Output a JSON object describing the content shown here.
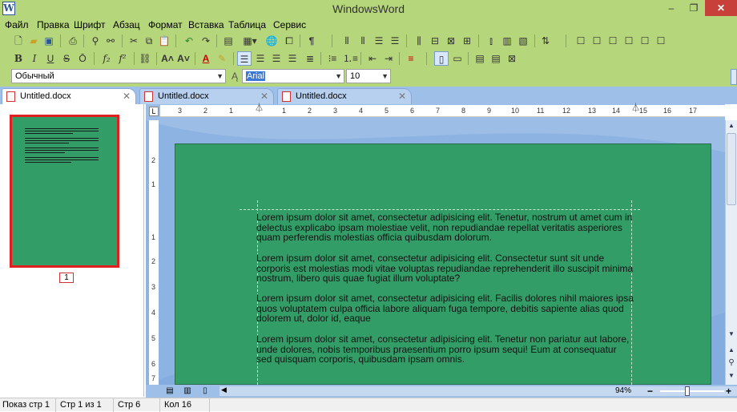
{
  "window": {
    "title": "WindowsWord",
    "app_icon_letter": "W",
    "minimize": "‒",
    "maximize": "❐",
    "close": "✕"
  },
  "menu": [
    "Файл",
    "Правка",
    "Шрифт",
    "Абзац",
    "Формат",
    "Вставка",
    "Таблица",
    "Сервис"
  ],
  "format_bar": {
    "style": "Обычный",
    "font": "Arial",
    "size": "10",
    "format_buttons": [
      "B",
      "I",
      "U",
      "S",
      "Ō",
      "f₂",
      "f²"
    ]
  },
  "tabs": [
    {
      "label": "Untitled.docx",
      "active": true
    },
    {
      "label": "Untitled.docx",
      "active": false
    },
    {
      "label": "Untitled.docx",
      "active": false
    }
  ],
  "tab_close": "✕",
  "thumbnail": {
    "page_number": "1"
  },
  "ruler": {
    "corner": "L",
    "h_labels": [
      "3",
      "2",
      "1",
      "1",
      "2",
      "3",
      "4",
      "5",
      "6",
      "7",
      "8",
      "9",
      "10",
      "11",
      "12",
      "13",
      "14",
      "15",
      "16",
      "17"
    ],
    "v_labels": [
      "2",
      "1",
      "1",
      "2",
      "3",
      "4",
      "5",
      "6",
      "7"
    ]
  },
  "document": {
    "paragraphs": [
      "Lorem ipsum dolor sit amet, consectetur adipisicing elit. Tenetur, nostrum ut amet cum in delectus explicabo ipsam molestiae velit, non repudiandae repellat veritatis asperiores quam perferendis molestias officia quibusdam dolorum.",
      "Lorem ipsum dolor sit amet, consectetur adipisicing elit. Consectetur sunt sit unde corporis est molestias modi vitae voluptas repudiandae reprehenderit illo suscipit minima nostrum, libero quis quae fugiat illum voluptate?",
      "Lorem ipsum dolor sit amet, consectetur adipisicing elit. Facilis dolores nihil maiores ipsa quos voluptatem culpa officia labore aliquam fuga tempore, debitis sapiente alias quod dolorem ut, dolor id, eaque",
      "Lorem ipsum dolor sit amet, consectetur adipisicing elit. Tenetur non pariatur aut labore, unde dolores, nobis temporibus praesentium porro ipsum sequi! Eum at consequatur sed quisquam corporis, quibusdam ipsam omnis."
    ]
  },
  "zoom": {
    "label": "94%",
    "minus": "−",
    "plus": "+"
  },
  "status": [
    "Показ стр 1",
    "Стр 1 из 1",
    "Стр 6",
    "Кол 16"
  ]
}
